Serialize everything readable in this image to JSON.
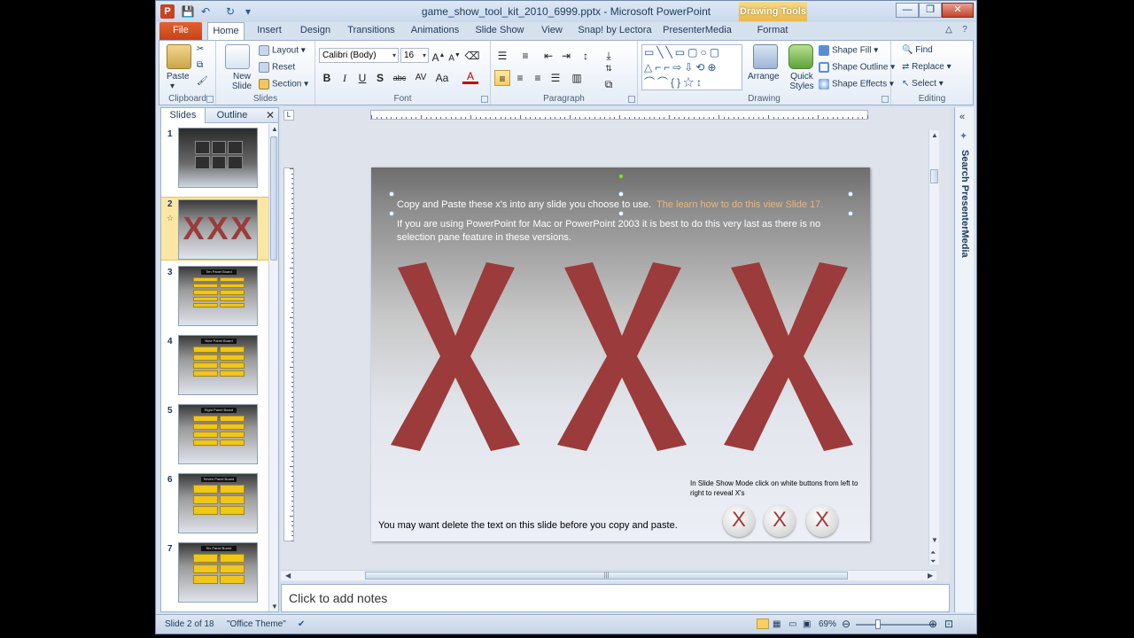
{
  "window": {
    "title": "game_show_tool_kit_2010_6999.pptx - Microsoft PowerPoint",
    "contextual_tab_group": "Drawing Tools",
    "controls": [
      "—",
      "❐",
      "✕"
    ]
  },
  "tabs": [
    {
      "label": "File",
      "active": false
    },
    {
      "label": "Home",
      "active": true
    },
    {
      "label": "Insert",
      "active": false
    },
    {
      "label": "Design",
      "active": false
    },
    {
      "label": "Transitions",
      "active": false
    },
    {
      "label": "Animations",
      "active": false
    },
    {
      "label": "Slide Show",
      "active": false
    },
    {
      "label": "View",
      "active": false
    },
    {
      "label": "Snap! by Lectora",
      "active": false
    },
    {
      "label": "PresenterMedia",
      "active": false
    },
    {
      "label": "Format",
      "active": false
    }
  ],
  "ribbon": {
    "clipboard": {
      "label": "Clipboard",
      "paste": "Paste"
    },
    "slides": {
      "label": "Slides",
      "new_slide": "New Slide",
      "layout": "Layout",
      "reset": "Reset",
      "section": "Section"
    },
    "font": {
      "label": "Font",
      "font_name": "Calibri (Body)",
      "font_size": "16",
      "bold": "B",
      "italic": "I",
      "underline": "U",
      "shadow": "S",
      "strike": "abc",
      "spacing": "AV",
      "case": "Aa",
      "color": "A"
    },
    "paragraph": {
      "label": "Paragraph"
    },
    "drawing": {
      "label": "Drawing",
      "arrange": "Arrange",
      "quick_styles": "Quick Styles",
      "shape_fill": "Shape Fill",
      "shape_outline": "Shape Outline",
      "shape_effects": "Shape Effects"
    },
    "editing": {
      "label": "Editing",
      "find": "Find",
      "replace": "Replace",
      "select": "Select"
    }
  },
  "left_pane": {
    "tabs": [
      "Slides",
      "Outline"
    ],
    "thumbnails": [
      {
        "num": "1",
        "title": "",
        "selected": false
      },
      {
        "num": "2",
        "title": "",
        "selected": true
      },
      {
        "num": "3",
        "title": "Ten Panel Board",
        "selected": false
      },
      {
        "num": "4",
        "title": "Nine Panel Board",
        "selected": false
      },
      {
        "num": "5",
        "title": "Eight Panel Board",
        "selected": false
      },
      {
        "num": "6",
        "title": "Seven Panel Board",
        "selected": false
      },
      {
        "num": "7",
        "title": "Six Panel Board",
        "selected": false
      }
    ]
  },
  "slide": {
    "line1_white": "Copy and Paste these x's into any slide you choose to use.",
    "line1_orange": "The learn how to do this view Slide 17.",
    "line2a": "If you are using  PowerPoint for Mac or PowerPoint 2003 it is best to do this very last as there is no",
    "line2b": "selection pane feature in these versions.",
    "big_x_count": 3,
    "hint1": "In Slide Show Mode click on white buttons  from left to",
    "hint2": "right to reveal X's",
    "bottom_text": "You may want delete the text on this slide before you copy and paste.",
    "buttons": [
      "X",
      "X",
      "X"
    ],
    "x_color": "#9b3b3b",
    "orange_color": "#f0b47a"
  },
  "notes_placeholder": "Click to add notes",
  "right_pane_label": "Search PresenterMedia",
  "status": {
    "slide_info": "Slide 2 of 18",
    "theme": "\"Office Theme\"",
    "zoom": "69%"
  }
}
